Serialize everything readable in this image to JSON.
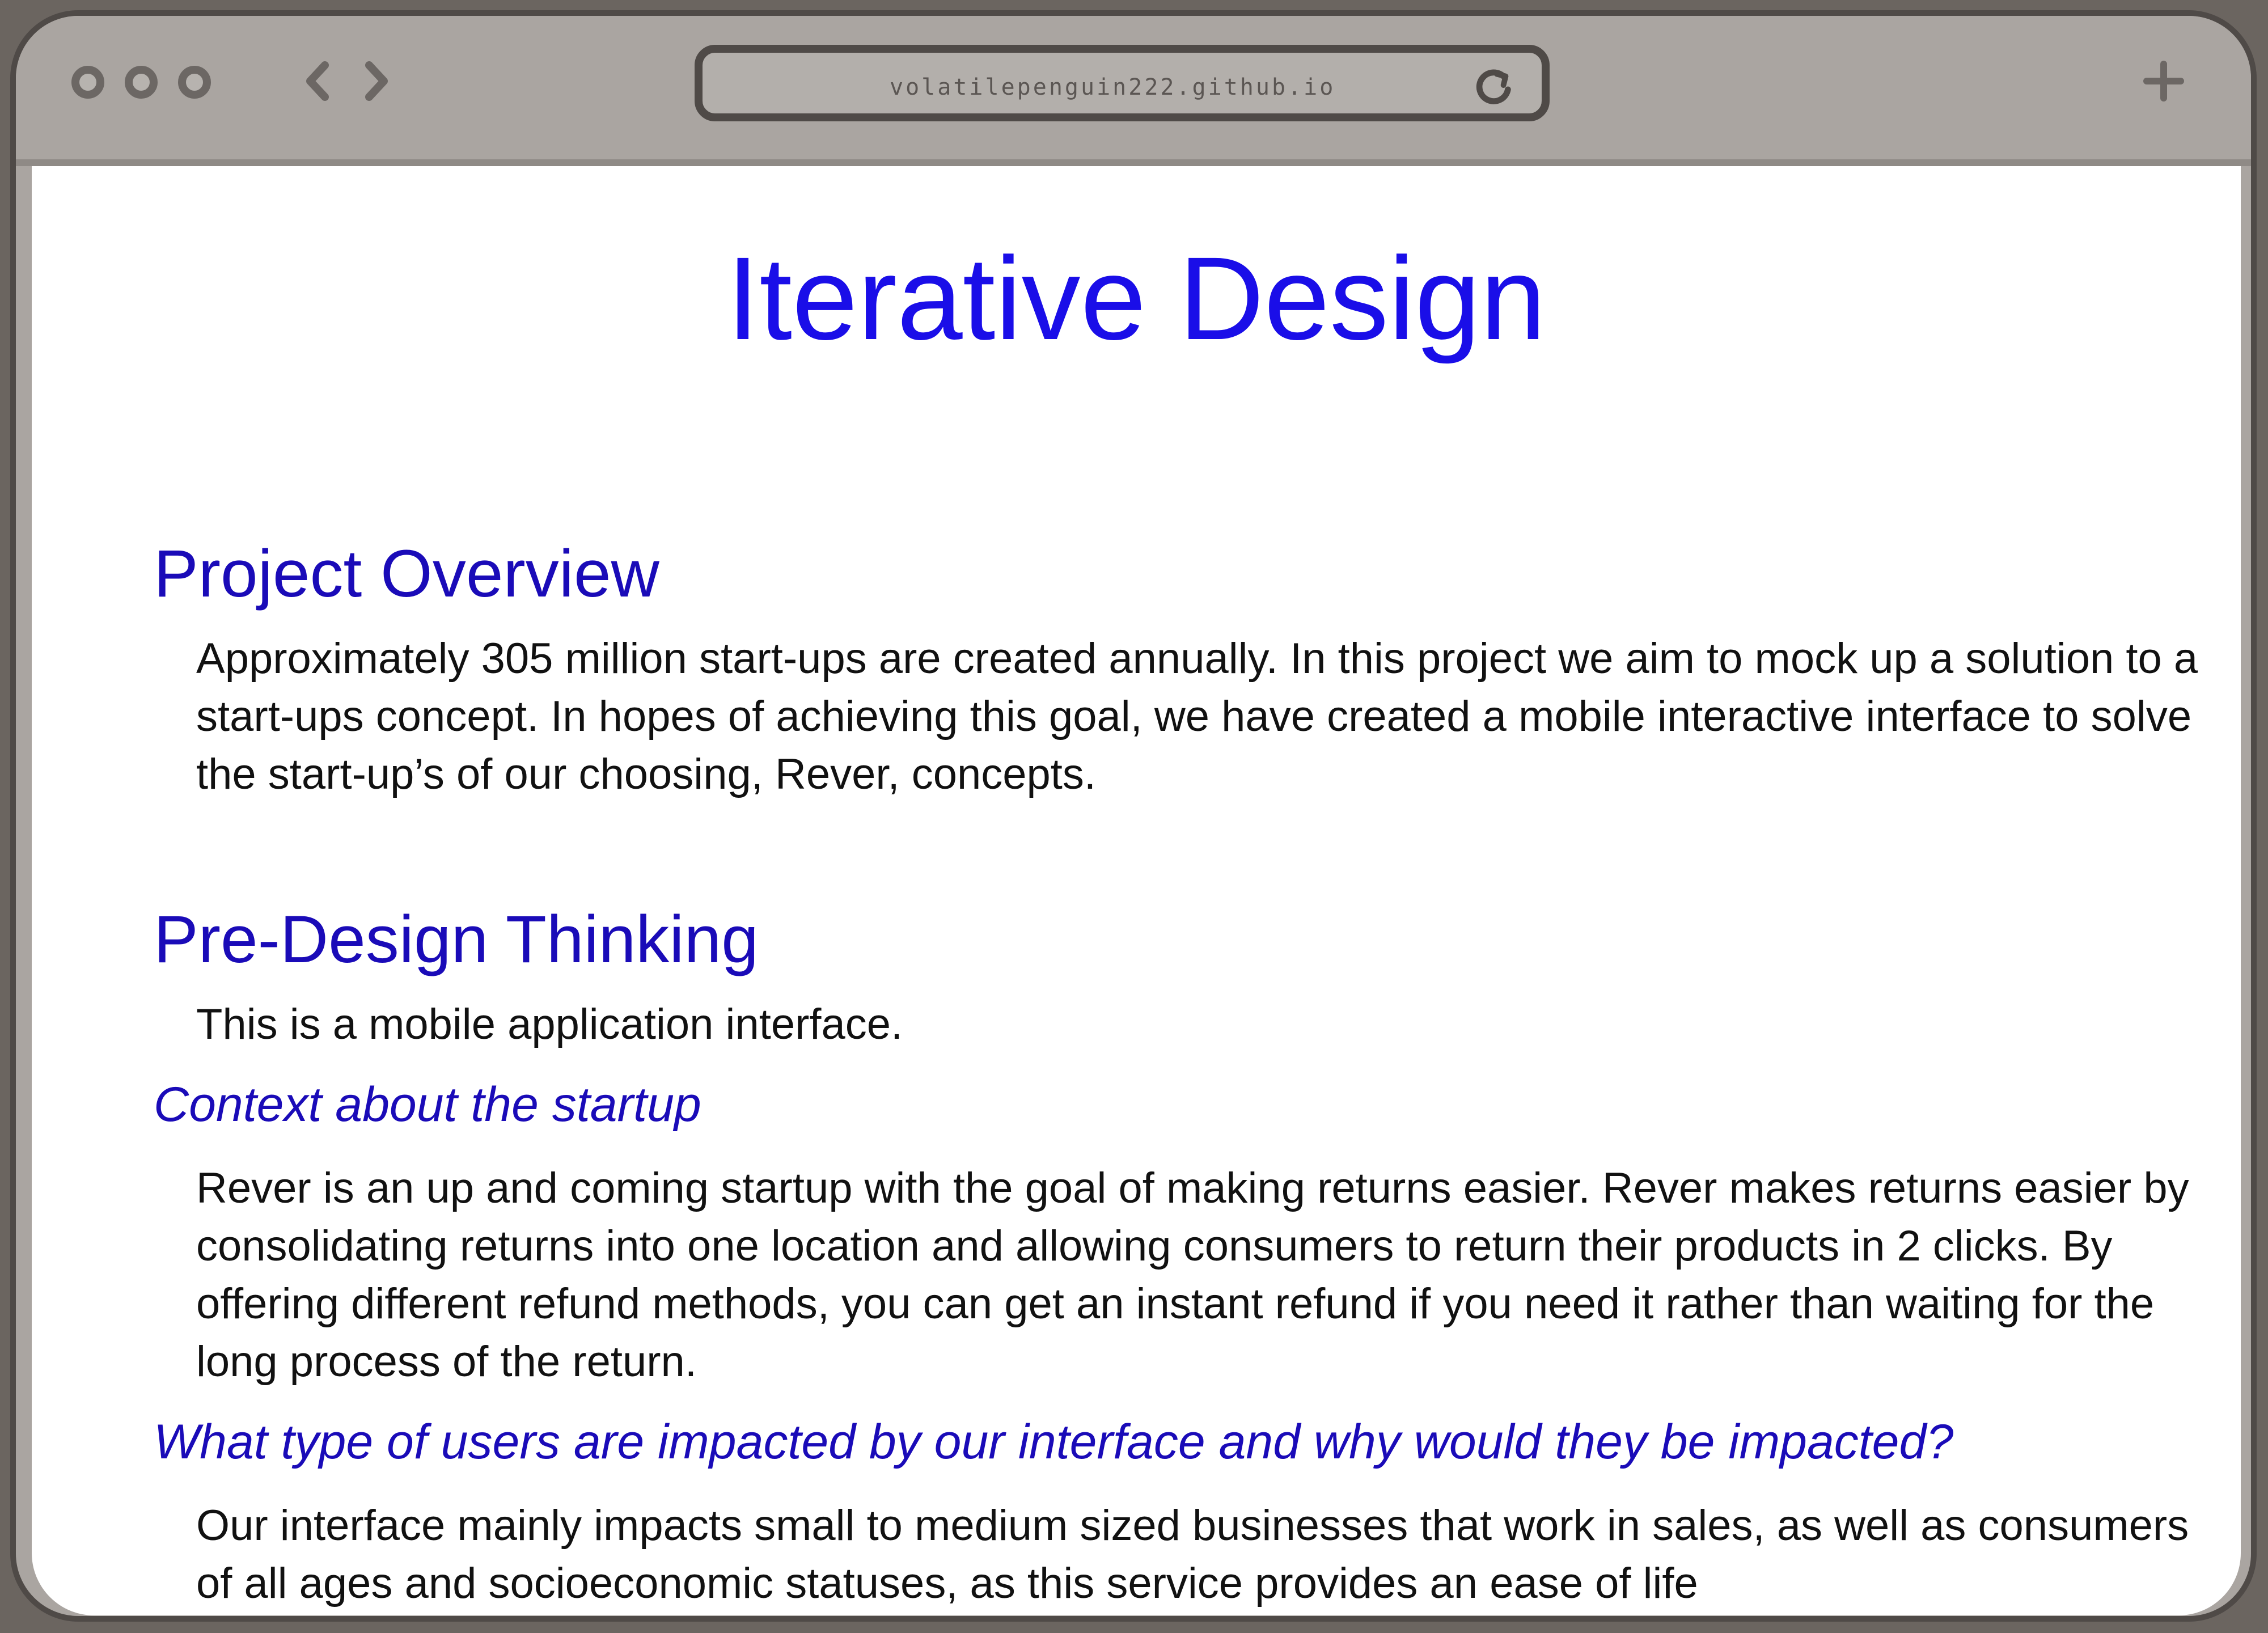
{
  "browser": {
    "url": "volatilepenguin222.github.io",
    "icons": {
      "window_controls": "traffic-light-dots",
      "back": "chevron-left-icon",
      "forward": "chevron-right-icon",
      "reload": "reload-icon",
      "new_tab": "plus-icon"
    }
  },
  "page": {
    "title": "Iterative Design",
    "sections": [
      {
        "heading": "Project Overview",
        "body": "Approximately 305 million start-ups are created annually. In this project we aim to mock up a solution to a start-ups concept. In hopes of achieving this goal, we have created a mobile interactive interface to solve the start-up’s of our choosing, Rever, concepts."
      },
      {
        "heading": "Pre-Design Thinking",
        "body": "This is a mobile application interface.",
        "subsections": [
          {
            "heading": "Context about the startup",
            "body": "Rever is an up and coming startup with the goal of making returns easier. Rever makes returns easier by consolidating returns into one location and allowing consumers to return their products in 2 clicks. By offering different refund methods, you can get an instant refund if you need it rather than waiting for the long process of the return."
          },
          {
            "heading": "What type of users are impacted by our interface and why would they be impacted?",
            "body": "Our interface mainly impacts small to medium sized businesses that work in sales, as well as consumers of all ages and socioeconomic statuses, as this service provides an ease of life"
          }
        ]
      }
    ]
  },
  "colors": {
    "title": "#1a0ee8",
    "heading": "#1a0bb8",
    "text": "#111111",
    "chrome": "#aaa5a1",
    "frame": "#4f4a47"
  }
}
